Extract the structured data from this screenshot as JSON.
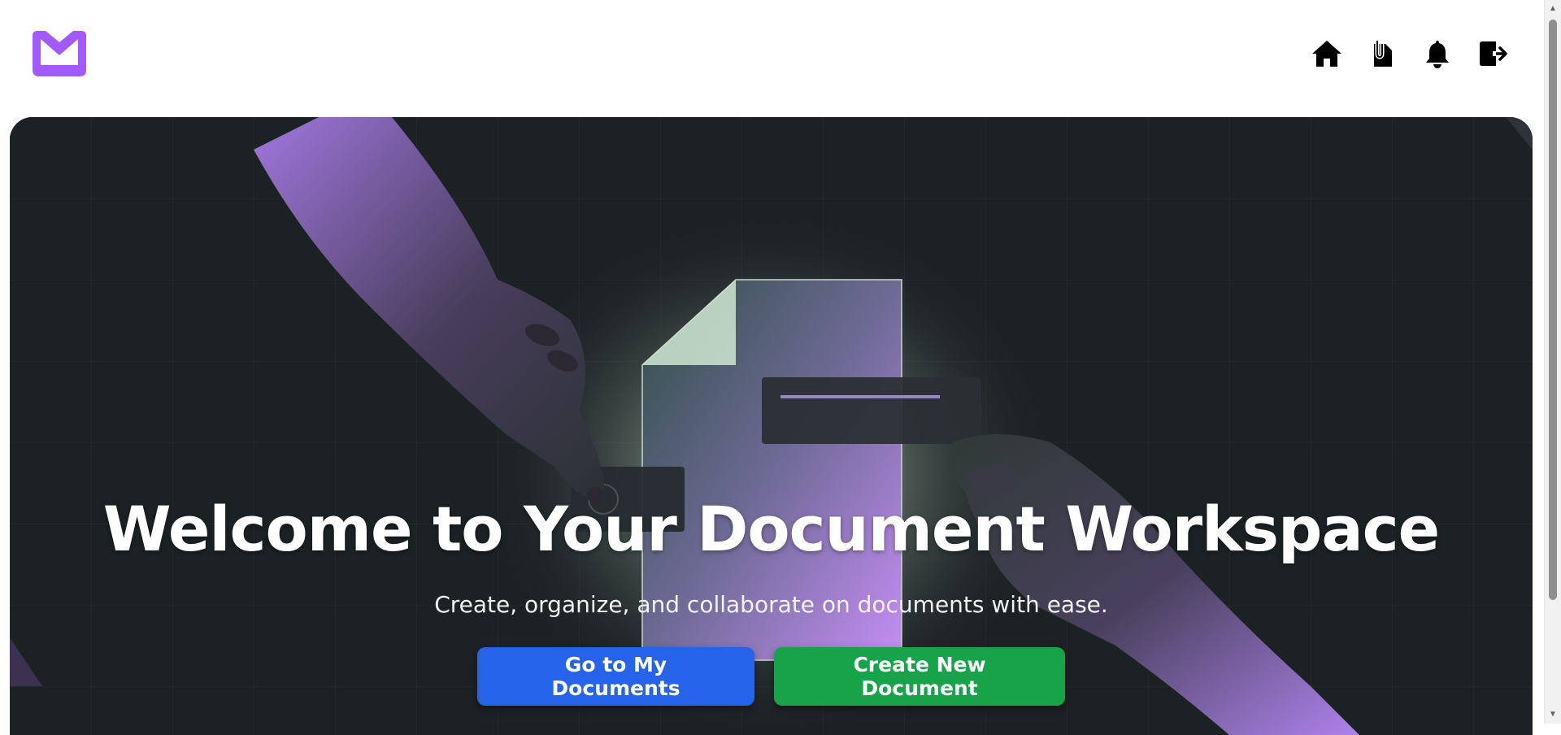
{
  "header": {
    "logo_icon": "purple-folder-logo",
    "brand_color": "#a259ff",
    "nav": [
      {
        "name": "home",
        "icon": "home-icon"
      },
      {
        "name": "documents",
        "icon": "document-clip-icon"
      },
      {
        "name": "notifications",
        "icon": "bell-icon"
      },
      {
        "name": "logout",
        "icon": "logout-icon"
      }
    ]
  },
  "hero": {
    "title": "Welcome to Your Document Workspace",
    "subtitle": "Create, organize, and collaborate on documents with ease.",
    "primary_button": "Go to My Documents",
    "secondary_button": "Create New Document",
    "primary_color": "#2563eb",
    "secondary_color": "#16a34a",
    "illustration": "hands-passing-glowing-document"
  }
}
